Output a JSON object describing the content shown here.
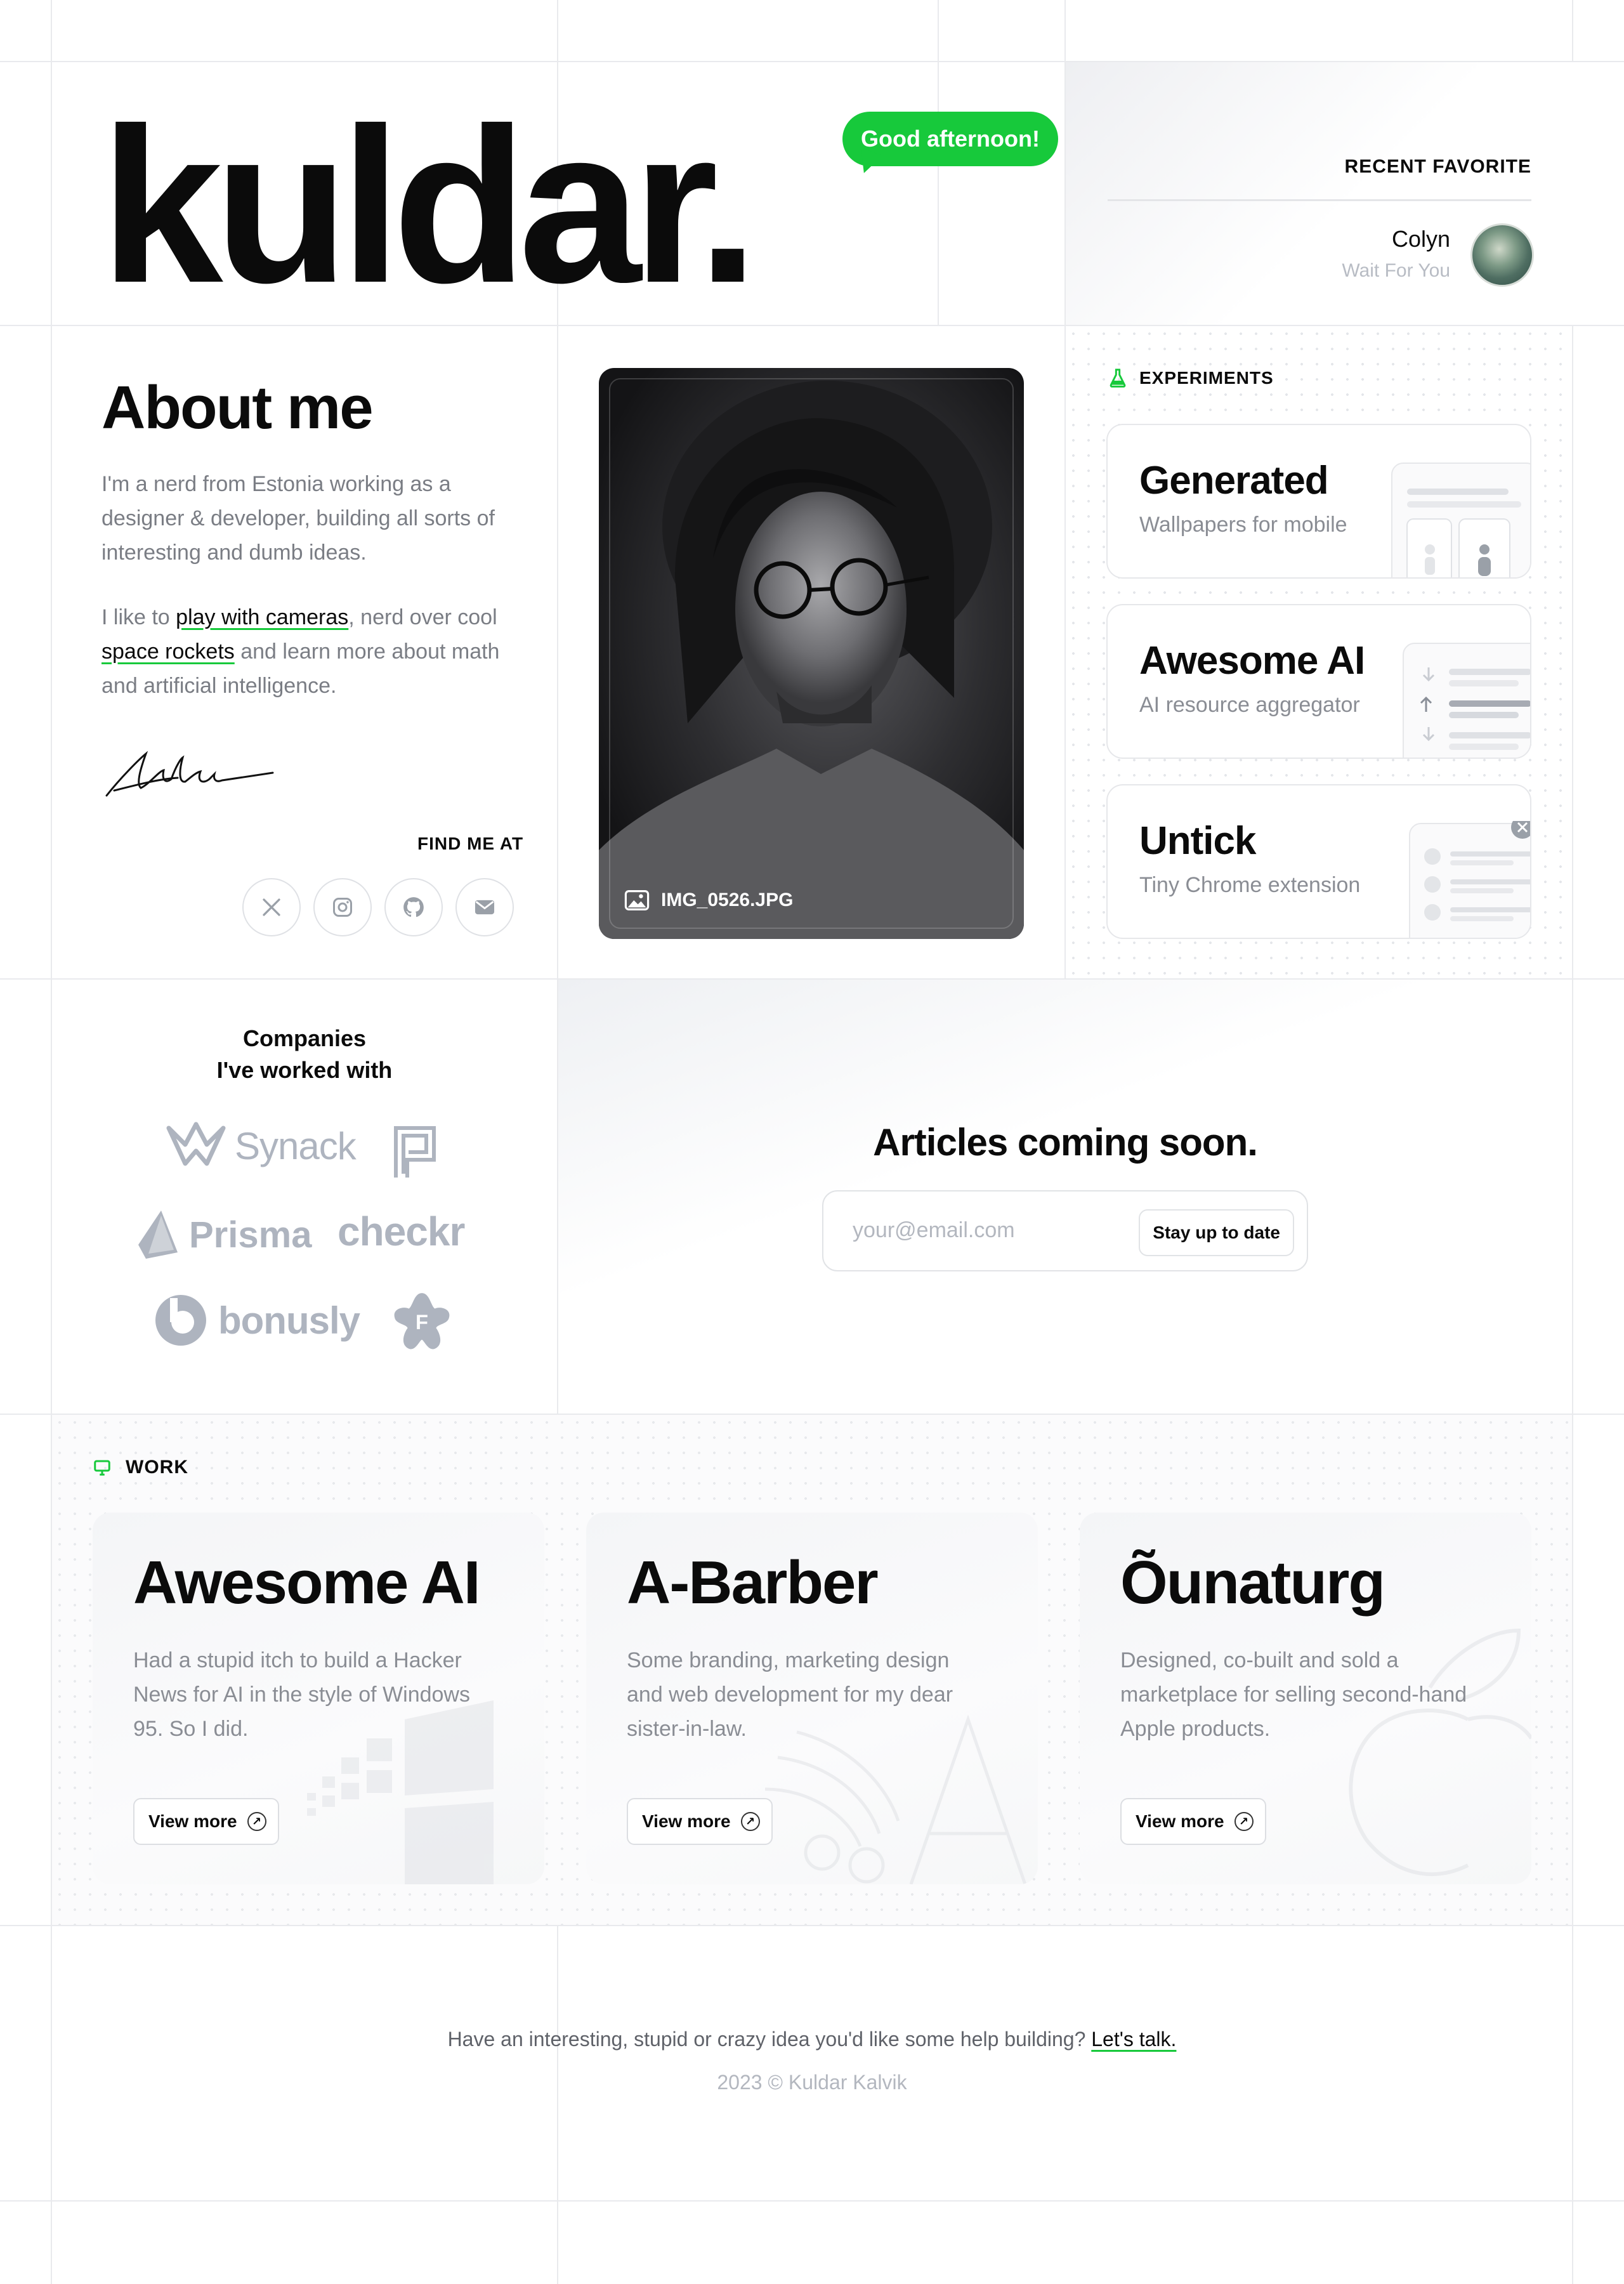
{
  "header": {
    "logo": "kuldar.",
    "greeting": "Good afternoon!",
    "recent_favorite": {
      "label": "RECENT FAVORITE",
      "artist": "Colyn",
      "track": "Wait For You"
    }
  },
  "about": {
    "title": "About me",
    "para1": "I'm a nerd from Estonia working as a designer & developer, building all sorts of interesting and dumb ideas.",
    "para2_pre": "I like to ",
    "para2_link1": "play with cameras",
    "para2_mid1": ", nerd over cool ",
    "para2_link2": "space rockets",
    "para2_post": " and learn more about math and artificial intelligence.",
    "find_me": "FIND ME AT",
    "socials": [
      "x-icon",
      "instagram-icon",
      "github-icon",
      "mail-icon"
    ]
  },
  "photo": {
    "caption": "IMG_0526.JPG"
  },
  "experiments": {
    "label": "EXPERIMENTS",
    "items": [
      {
        "title": "Generated",
        "subtitle": "Wallpapers for mobile"
      },
      {
        "title": "Awesome AI",
        "subtitle": "AI resource aggregator"
      },
      {
        "title": "Untick",
        "subtitle": "Tiny Chrome extension"
      }
    ]
  },
  "companies": {
    "title_line1": "Companies",
    "title_line2": "I've worked with",
    "logos": [
      "Synack",
      "Prisma",
      "checkr",
      "bonusly"
    ]
  },
  "articles": {
    "title": "Articles coming soon.",
    "placeholder": "your@email.com",
    "button": "Stay up to date"
  },
  "work": {
    "label": "WORK",
    "items": [
      {
        "title": "Awesome AI",
        "description": "Had a stupid itch to build a Hacker News for AI in the style of Windows 95. So I did.",
        "button": "View more"
      },
      {
        "title": "A-Barber",
        "description": "Some branding, marketing design and web development for my dear sister-in-law.",
        "button": "View more"
      },
      {
        "title": "Õunaturg",
        "description": "Designed, co-built and sold a marketplace for selling second-hand Apple products.",
        "button": "View more"
      }
    ]
  },
  "footer": {
    "text": "Have an interesting, stupid or crazy idea you'd like some help building?",
    "link": "Let's talk.",
    "copyright": "2023 © Kuldar Kalvik"
  },
  "colors": {
    "accent": "#17c93b",
    "text": "#0b0b0b",
    "muted": "#8a8d94",
    "grid": "#e9eaed"
  }
}
